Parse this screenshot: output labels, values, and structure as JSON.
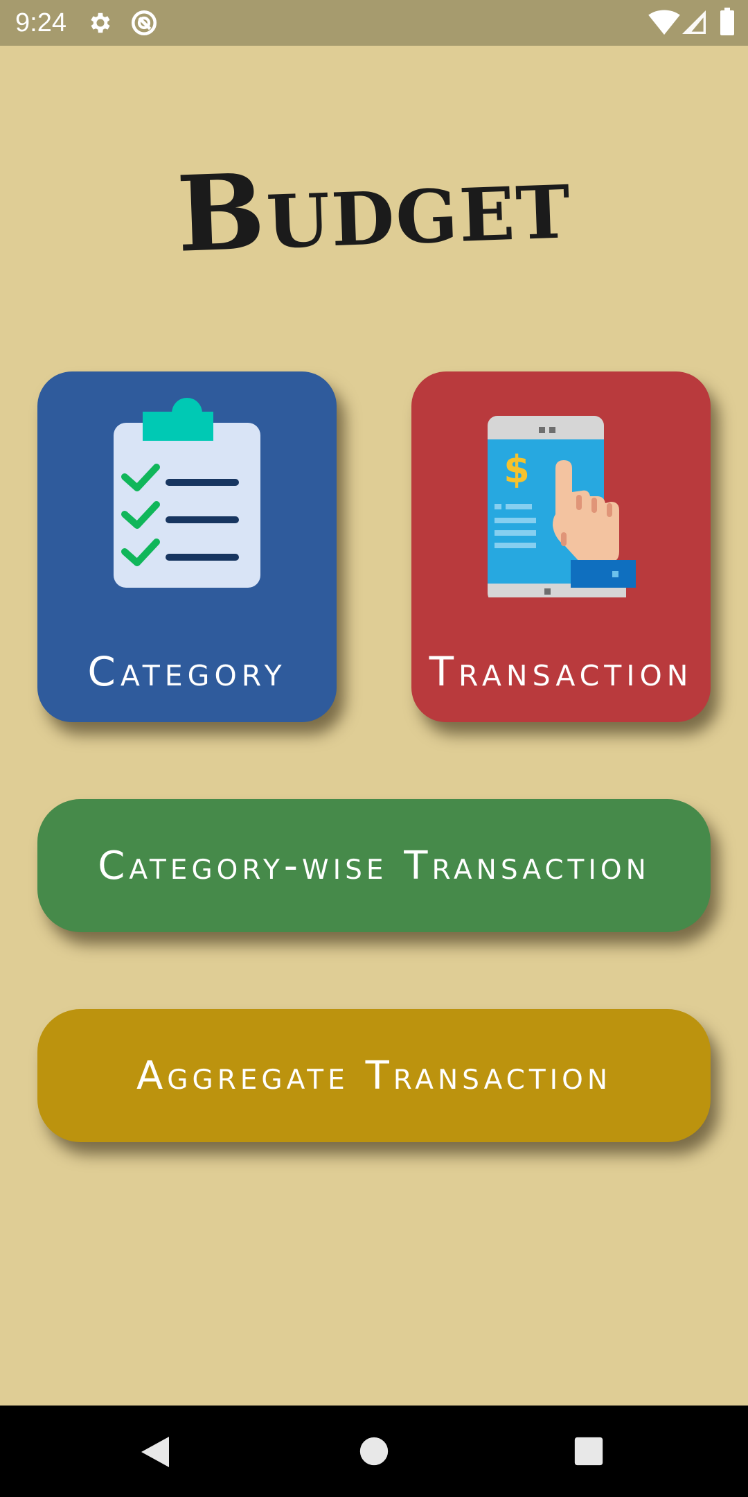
{
  "status_bar": {
    "time": "9:24",
    "icons": [
      "gear-icon",
      "sync-icon",
      "wifi-icon",
      "cell-signal-icon",
      "battery-icon"
    ]
  },
  "app": {
    "title": "Budget"
  },
  "tiles": {
    "category": {
      "label": "Category",
      "icon": "clipboard-checklist-icon",
      "color": "#2F5B9C"
    },
    "transaction": {
      "label": "Transaction",
      "icon": "phone-payment-icon",
      "color": "#B93A3D"
    }
  },
  "buttons": {
    "category_wise": {
      "label": "Category-wise Transaction",
      "color": "#468A4A"
    },
    "aggregate": {
      "label": "Aggregate Transaction",
      "color": "#BC930E"
    }
  },
  "nav_bar": {
    "icons": [
      "back-icon",
      "home-icon",
      "recents-icon"
    ]
  },
  "colors": {
    "background": "#DFCD95",
    "status_bar": "#A69B6E"
  }
}
